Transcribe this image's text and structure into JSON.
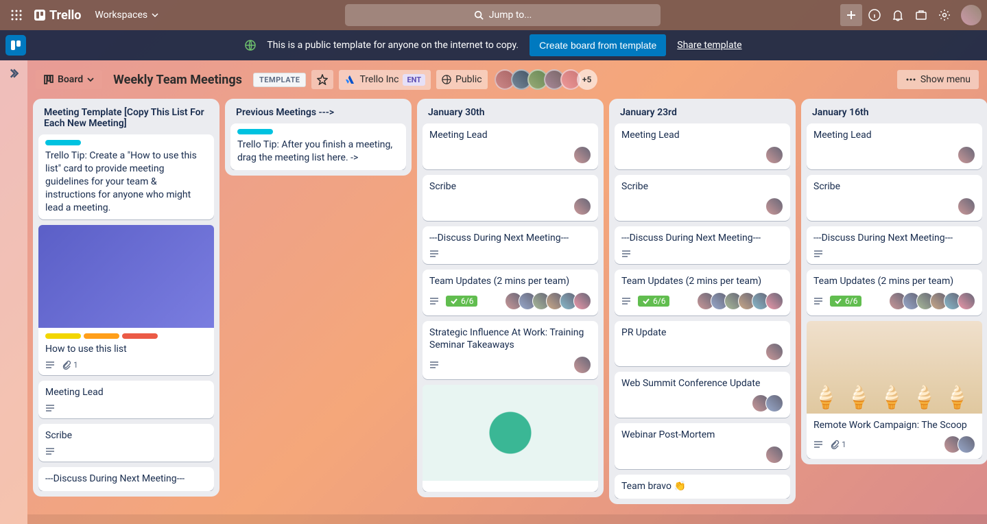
{
  "nav": {
    "product": "Trello",
    "workspaces": "Workspaces",
    "searchPlaceholder": "Jump to..."
  },
  "banner": {
    "text": "This is a public template for anyone on the internet to copy.",
    "createBtn": "Create board from template",
    "shareLink": "Share template"
  },
  "board": {
    "viewBtn": "Board",
    "title": "Weekly Team Meetings",
    "templateBadge": "TEMPLATE",
    "workspace": "Trello Inc",
    "workspaceBadge": "ENT",
    "visibility": "Public",
    "membersMore": "+5",
    "showMenu": "Show menu"
  },
  "colors": {
    "cyan": "#00c2e0",
    "yellow": "#f2d600",
    "orange": "#ff9f1a",
    "red": "#eb5a46"
  },
  "lists": [
    {
      "title": "Meeting Template [Copy This List For Each New Meeting]",
      "cards": [
        {
          "labels": [
            "cyan"
          ],
          "title": "Trello Tip: Create a \"How to use this list\" card to provide meeting guidelines for your team & instructions for anyone who might lead a meeting."
        },
        {
          "cover": "image",
          "labels": [
            "yellow",
            "orange",
            "red"
          ],
          "title": "How to use this list",
          "desc": true,
          "attachments": "1"
        },
        {
          "title": "Meeting Lead",
          "desc": true
        },
        {
          "title": "Scribe",
          "desc": true
        },
        {
          "title": "---Discuss During Next Meeting---"
        }
      ]
    },
    {
      "title": "Previous Meetings --->",
      "cards": [
        {
          "labels": [
            "cyan"
          ],
          "title": "Trello Tip: After you finish a meeting, drag the meeting list here. ->"
        }
      ]
    },
    {
      "title": "January 30th",
      "cards": [
        {
          "title": "Meeting Lead",
          "members": 1
        },
        {
          "title": "Scribe",
          "members": 1
        },
        {
          "title": "---Discuss During Next Meeting---",
          "desc": true
        },
        {
          "title": "Team Updates (2 mins per team)",
          "desc": true,
          "checklist": "6/6",
          "members": 6
        },
        {
          "title": "Strategic Influence At Work: Training Seminar Takeaways",
          "desc": true,
          "members": 1
        },
        {
          "cover": "mindmap",
          "title": ""
        }
      ]
    },
    {
      "title": "January 23rd",
      "cards": [
        {
          "title": "Meeting Lead",
          "members": 1
        },
        {
          "title": "Scribe",
          "members": 1
        },
        {
          "title": "---Discuss During Next Meeting---",
          "desc": true
        },
        {
          "title": "Team Updates (2 mins per team)",
          "desc": true,
          "checklist": "6/6",
          "members": 6
        },
        {
          "title": "PR Update",
          "members": 1
        },
        {
          "title": "Web Summit Conference Update",
          "members": 2
        },
        {
          "title": "Webinar Post-Mortem",
          "members": 1
        },
        {
          "title": "Team bravo 👏"
        }
      ]
    },
    {
      "title": "January 16th",
      "cards": [
        {
          "title": "Meeting Lead",
          "members": 1
        },
        {
          "title": "Scribe",
          "members": 1
        },
        {
          "title": "---Discuss During Next Meeting---",
          "desc": true
        },
        {
          "title": "Team Updates (2 mins per team)",
          "desc": true,
          "checklist": "6/6",
          "members": 6
        },
        {
          "cover": "icecream",
          "title": "Remote Work Campaign: The Scoop",
          "desc": true,
          "attachments": "1",
          "members": 2
        }
      ]
    }
  ]
}
